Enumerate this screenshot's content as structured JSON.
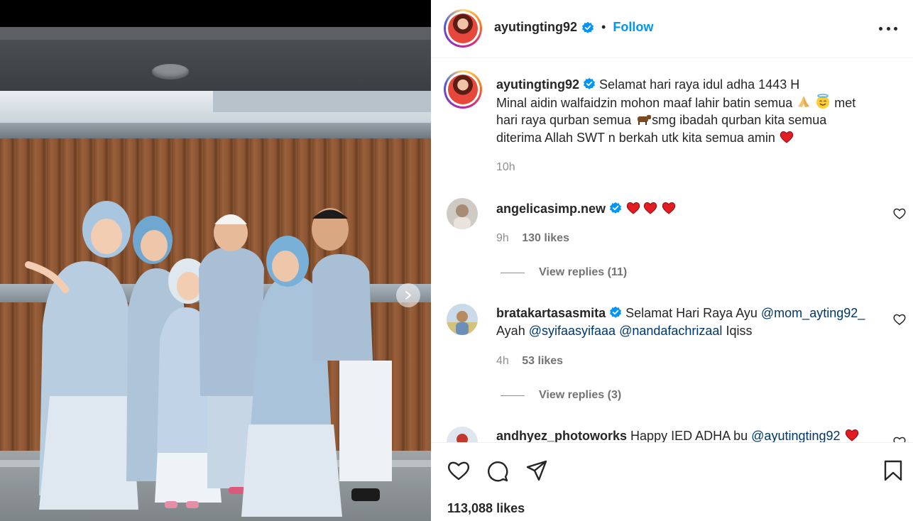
{
  "post": {
    "author": "ayutingting92",
    "follow_label": "Follow",
    "separator": "•",
    "caption_author": "ayutingting92",
    "caption_line1": "Selamat hari raya idul adha 1443 H",
    "caption_line2a": "Minal aidin walfaidzin mohon maaf lahir batin semua",
    "caption_line2b": "met",
    "caption_line3a": "hari raya qurban semua",
    "caption_line3b": "smg ibadah qurban kita semua",
    "caption_line4": "diterima Allah SWT n berkah utk kita semua amin",
    "caption_time": "10h",
    "likes": "113,088 likes"
  },
  "comments": [
    {
      "username": "angelicasimp.new",
      "time": "9h",
      "likes": "130 likes",
      "view_replies": "View replies (11)"
    },
    {
      "username": "bratakartasasmita",
      "text_a": "Selamat Hari Raya Ayu",
      "mention1": "@mom_ayting92_",
      "text_b": "Ayah",
      "mention2": "@syifaasyifaaa",
      "mention3": "@nandafachrizaal",
      "text_c": "Iqiss",
      "time": "4h",
      "likes": "53 likes",
      "view_replies": "View replies (3)"
    },
    {
      "username": "andhyez_photoworks",
      "text_a": "Happy IED ADHA bu",
      "mention1": "@ayutingting92"
    }
  ],
  "icons": {
    "verified": "verified-badge-icon",
    "more": "more-options-icon",
    "like": "heart-icon",
    "comment": "comment-icon",
    "share": "share-icon",
    "save": "bookmark-icon",
    "carousel_next": "chevron-right-icon"
  },
  "colors": {
    "link_blue": "#0095f6",
    "mention": "#00376b",
    "verified": "#0095f6",
    "heart_red": "#ed4956"
  }
}
